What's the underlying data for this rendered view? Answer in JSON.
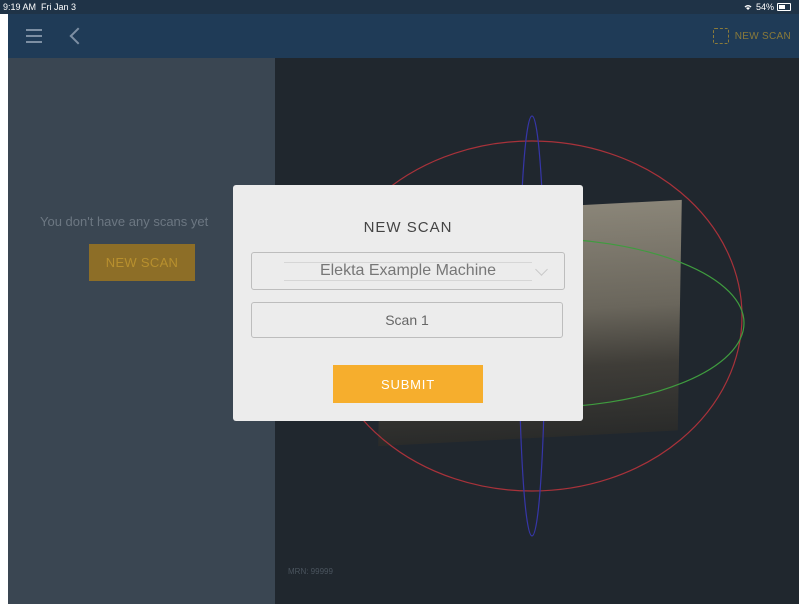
{
  "status_bar": {
    "time": "9:19 AM",
    "date": "Fri Jan 3",
    "battery": "54%"
  },
  "nav": {
    "new_scan_label": "NEW SCAN"
  },
  "left_panel": {
    "empty_message": "You don't have any scans yet",
    "new_scan_label": "NEW SCAN"
  },
  "right_panel": {
    "mrn": "MRN: 99999"
  },
  "modal": {
    "title": "NEW SCAN",
    "machine_value": "Elekta Example Machine",
    "scan_name_value": "Scan 1",
    "submit_label": "SUBMIT"
  },
  "colors": {
    "accent": "#f6ae2d",
    "nav_bg": "#1f3b57",
    "modal_bg": "#ececec"
  },
  "icons": {
    "menu": "hamburger-icon",
    "back": "back-chevron-icon",
    "scan": "scan-frame-icon",
    "wifi": "wifi-icon"
  }
}
